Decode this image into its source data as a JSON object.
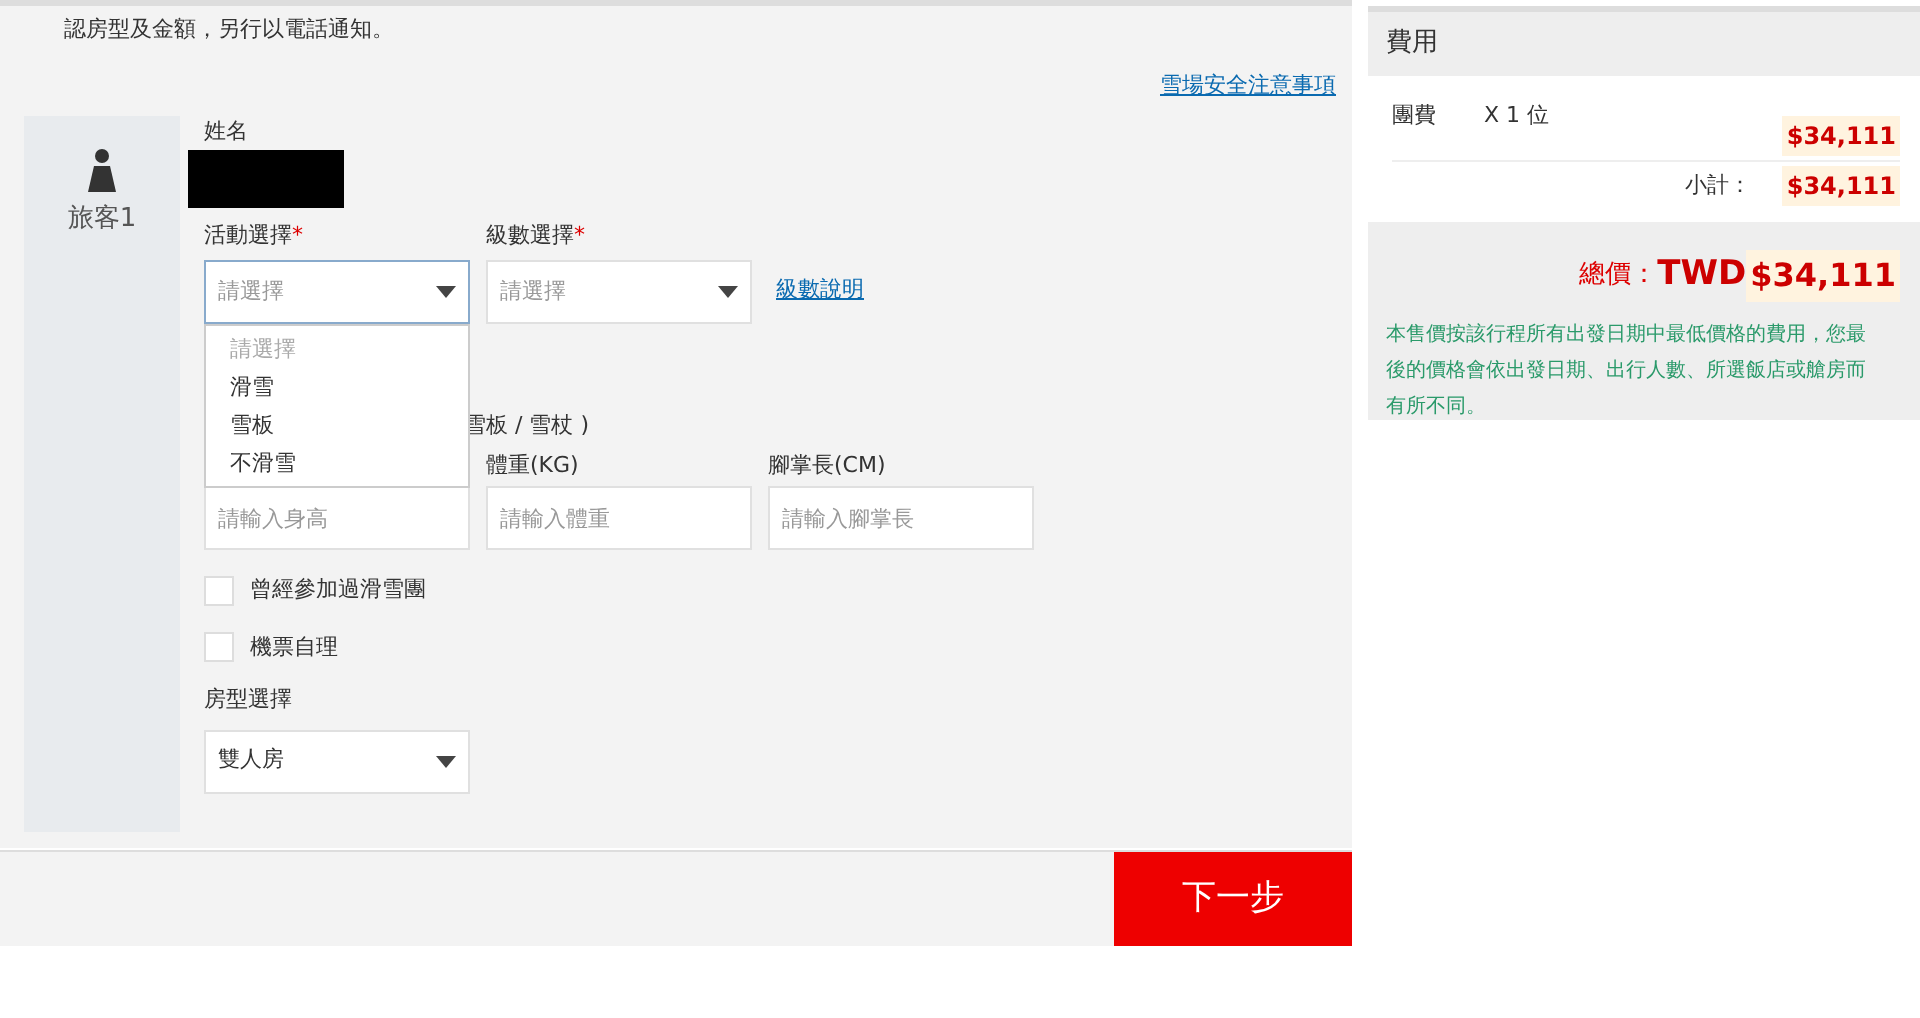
{
  "notice": "認房型及金額，另行以電話通知。",
  "safety_link": "雪場安全注意事項",
  "traveler": {
    "label": "旅客1",
    "name_label": "姓名",
    "activity": {
      "label": "活動選擇",
      "required_mark": "*",
      "placeholder": "請選擇",
      "expanded": true,
      "options": [
        {
          "label": "請選擇",
          "disabled": true
        },
        {
          "label": "滑雪",
          "disabled": false
        },
        {
          "label": "雪板",
          "disabled": false
        },
        {
          "label": "不滑雪",
          "disabled": false
        }
      ]
    },
    "level": {
      "label": "級數選擇",
      "required_mark": "*",
      "placeholder": "請選擇"
    },
    "level_link": "級數說明",
    "equipment_note": "雪板 / 雪杖 )",
    "measurements": [
      {
        "placeholder": "請輸入身高"
      },
      {
        "label": "體重(KG)",
        "placeholder": "請輸入體重"
      },
      {
        "label": "腳掌長(CM)",
        "placeholder": "請輸入腳掌長"
      }
    ],
    "checkboxes": [
      {
        "label": "曾經參加過滑雪團",
        "checked": false
      },
      {
        "label": "機票自理",
        "checked": false
      }
    ],
    "room": {
      "label": "房型選擇",
      "value": "雙人房"
    }
  },
  "next_button": "下一步",
  "fees": {
    "title": "費用",
    "item": {
      "name": "團費",
      "quantity": "X 1 位",
      "amount": "$34,111"
    },
    "subtotal_label": "小計：",
    "subtotal": "$34,111",
    "total_label": "總價：",
    "total_currency": "TWD",
    "total": "$34,111",
    "note": "本售價按該行程所有出發日期中最低價格的費用，您最後的價格會依出發日期、出行人數、所選飯店或艙房而有所不同。"
  }
}
